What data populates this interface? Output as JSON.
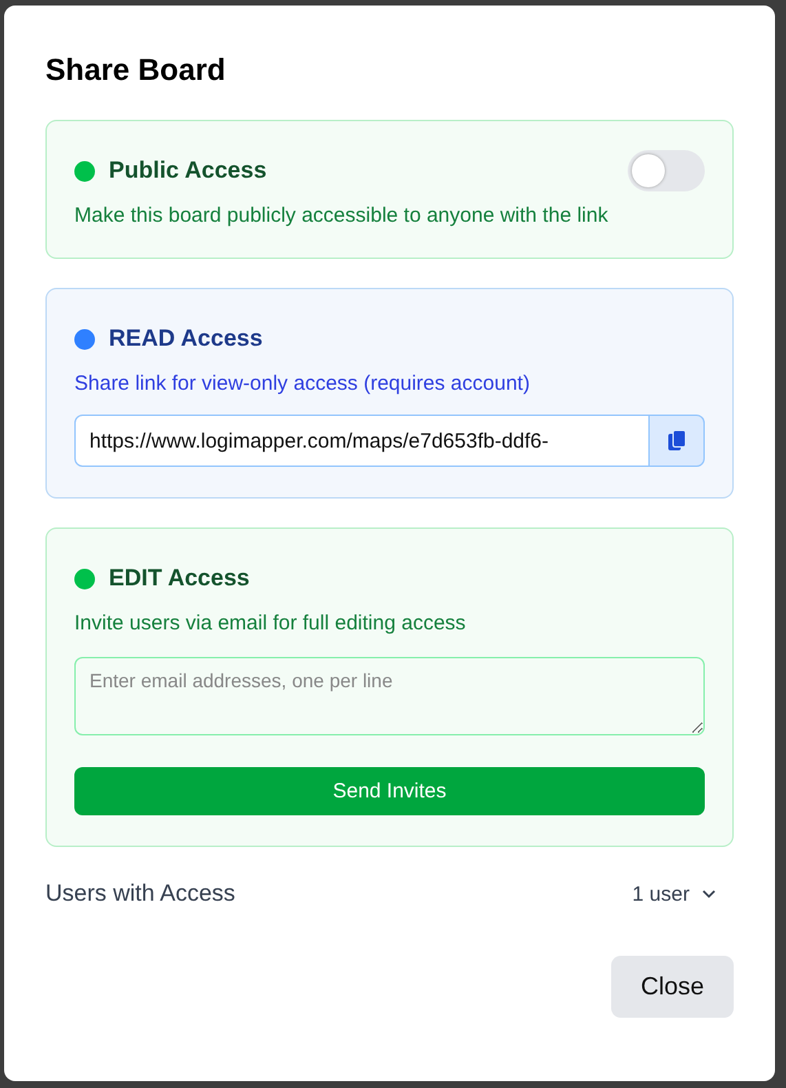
{
  "dialog": {
    "title": "Share Board"
  },
  "sections": [
    {
      "kind": "toggle",
      "title": "Public Access",
      "color": "#00c04b",
      "description": "Make this board publicly accessible to anyone with the link",
      "on": false
    },
    {
      "kind": "link",
      "title": "READ Access",
      "color": "#2f80ff",
      "description": "Share link for view-only access (requires account)",
      "link": "https://www.logimapper.com/maps/e7d653fb-ddf6-"
    },
    {
      "kind": "invite",
      "title": "EDIT Access",
      "color": "#00c04b",
      "description": "Invite users via email for full editing access",
      "placeholder": "Enter email addresses, one per line",
      "button": "Send Invites"
    }
  ],
  "users": {
    "label": "Users with Access",
    "count": "1 user",
    "expanded": false
  },
  "buttons": [
    "Close"
  ]
}
